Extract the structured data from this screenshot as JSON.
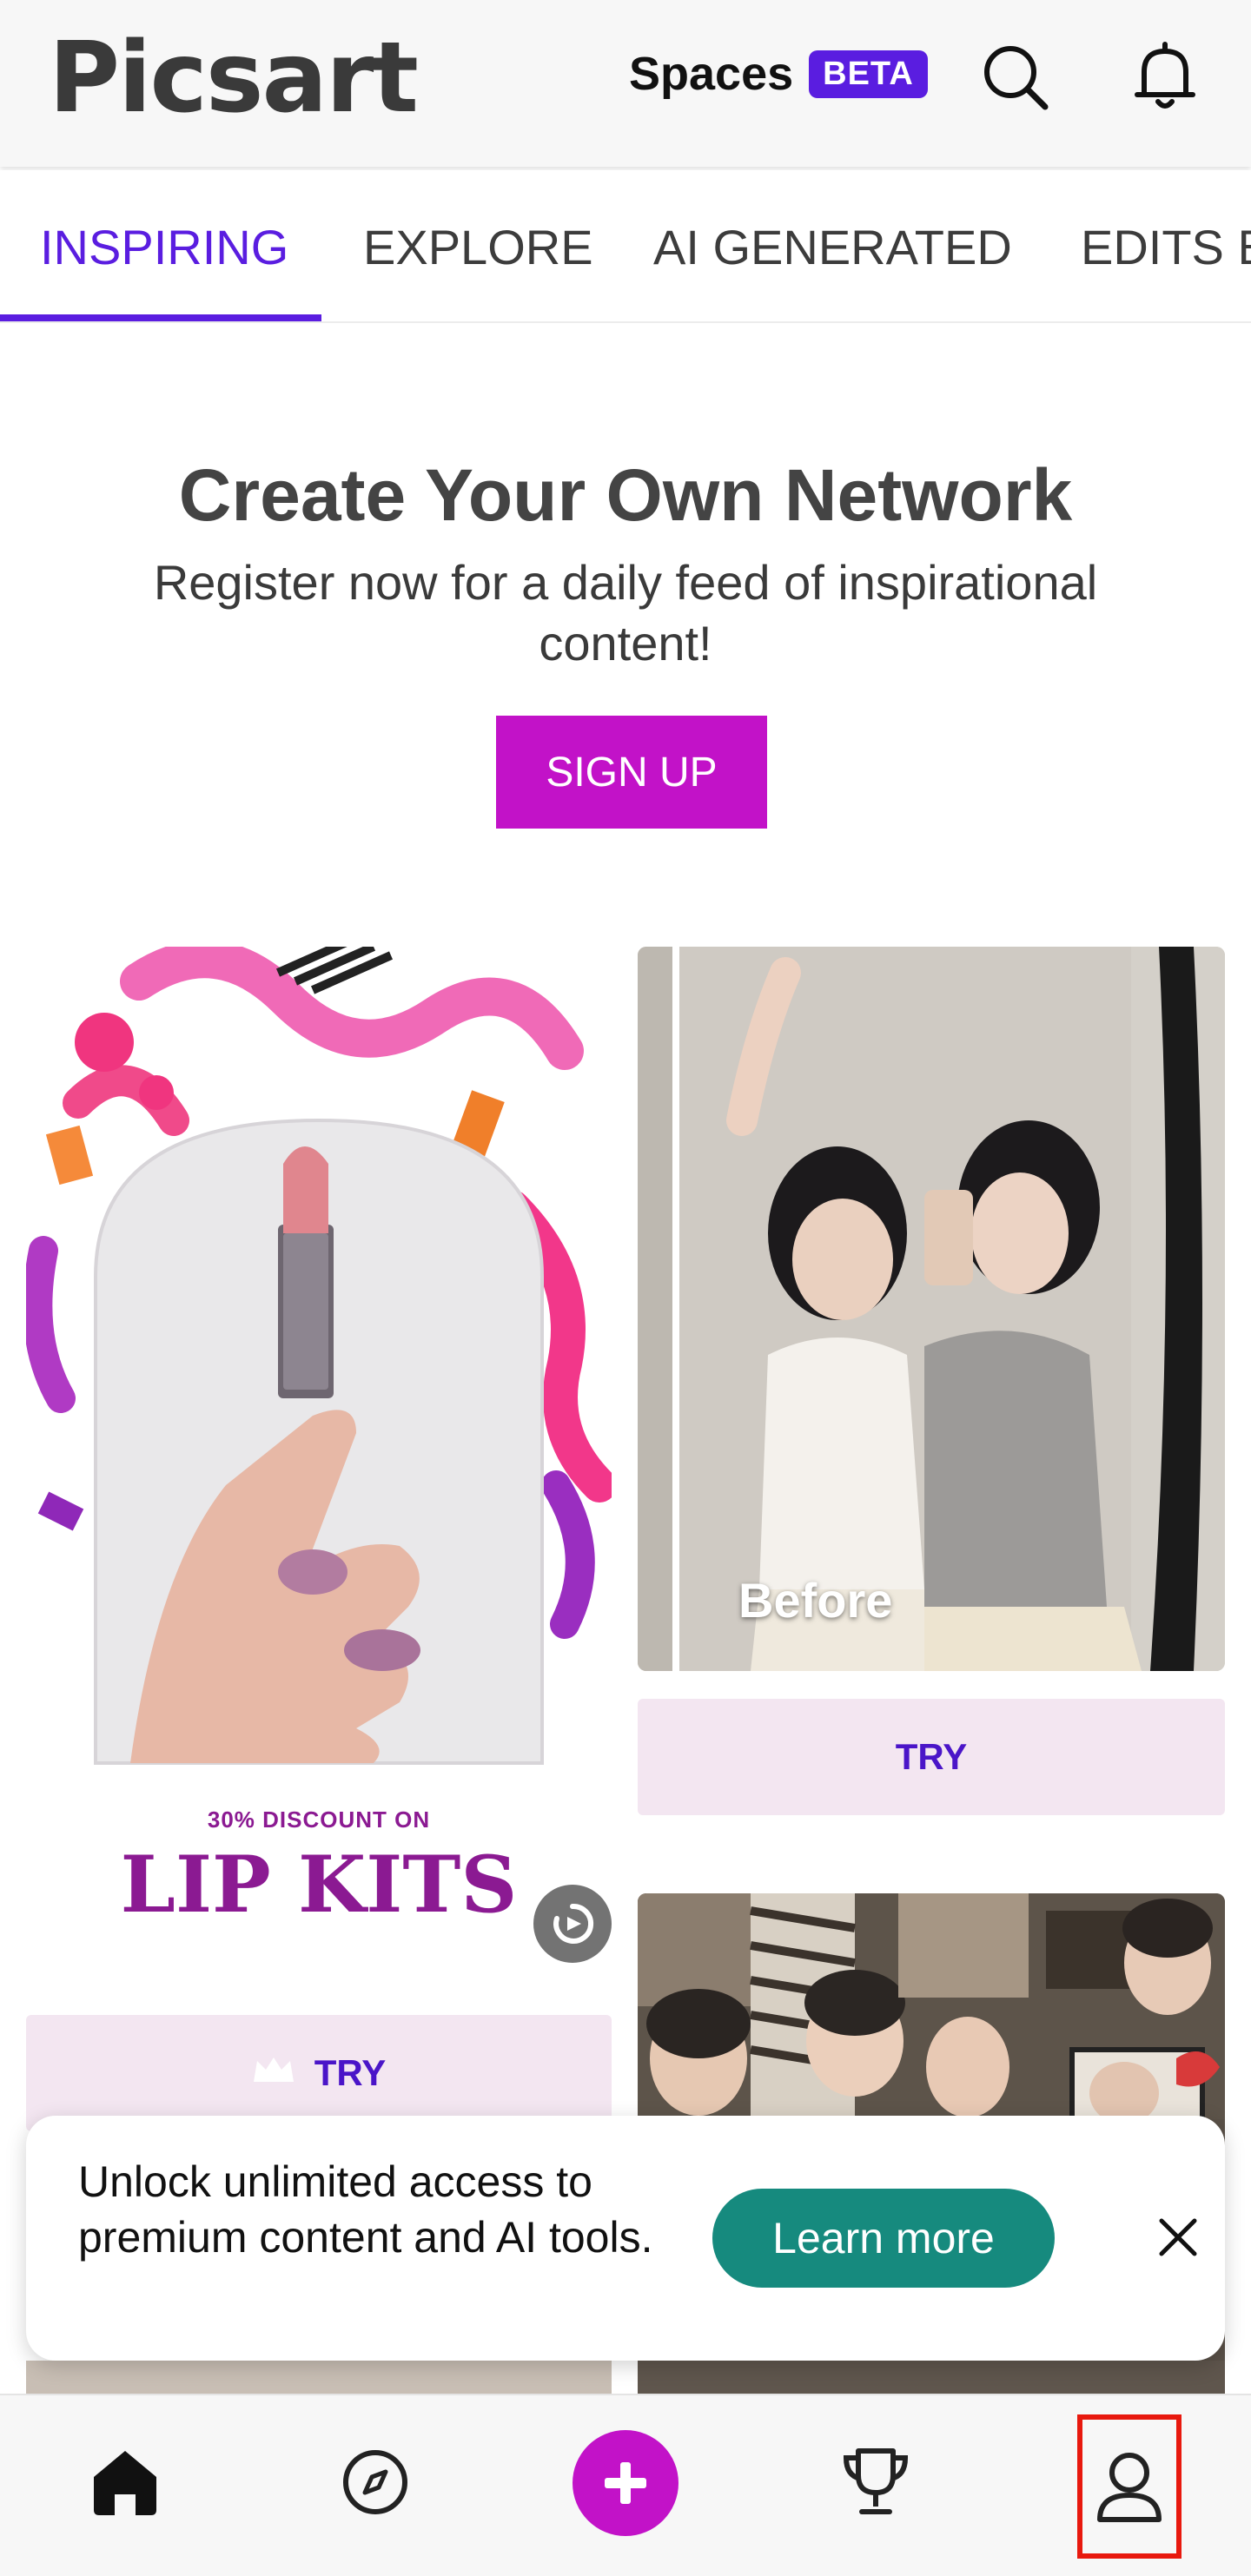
{
  "header": {
    "logo_text": "Picsart",
    "spaces_label": "Spaces",
    "beta_badge": "BETA",
    "search_icon": "search-icon",
    "notifications_icon": "bell-icon"
  },
  "tabs": [
    {
      "label": "INSPIRING",
      "active": true
    },
    {
      "label": "EXPLORE",
      "active": false
    },
    {
      "label": "AI GENERATED",
      "active": false
    },
    {
      "label": "EDITS B",
      "active": false
    }
  ],
  "hero": {
    "title": "Create Your Own Network",
    "subtitle": "Register now for a daily feed of inspirational content!",
    "signup_label": "SIGN UP"
  },
  "cards": {
    "lip": {
      "promo_small": "30% DISCOUNT ON",
      "promo_big": "LIP KITS",
      "try_label": "TRY"
    },
    "photo": {
      "before_label": "Before",
      "try_label": "TRY"
    }
  },
  "toast": {
    "text": "Unlock unlimited access to premium content and AI tools.",
    "learn_more_label": "Learn more"
  },
  "bottom_nav": [
    "home-icon",
    "compass-icon",
    "plus-icon",
    "trophy-icon",
    "profile-icon"
  ],
  "colors": {
    "accent_purple": "#5a1de0",
    "brand_magenta": "#c212c8",
    "teal": "#168a7e",
    "highlight_red": "#e8190e"
  }
}
